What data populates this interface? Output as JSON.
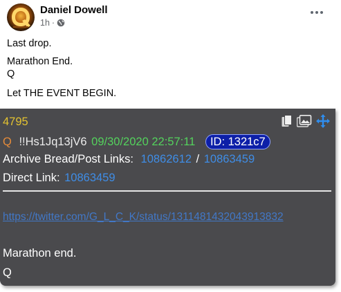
{
  "post": {
    "author": "Daniel Dowell",
    "time": "1h",
    "meta_sep": "·",
    "lines": [
      "Last drop.",
      "Marathon End.",
      "Q",
      "Let THE EVENT BEGIN."
    ],
    "privacy_icon": "globe-icon",
    "more_icon": "more-dots-icon"
  },
  "card": {
    "post_number": "4795",
    "q": "Q",
    "tripcode": "!!Hs1Jq13jV6",
    "date": "09/30/2020 22:57:11",
    "id": "ID: 1321c7",
    "archive_label": "Archive Bread/Post Links:",
    "archive_link_1": "10862612",
    "archive_slash": "/",
    "archive_link_2": "10863459",
    "direct_label": "Direct Link:",
    "direct_link": "10863459",
    "url": "https://twitter.com/G_L_C_K/status/1311481432043913832",
    "body_line_1": "Marathon end.",
    "body_line_2": "Q",
    "colors": {
      "card_bg": "#4a4a4d",
      "post_number": "#e3c231",
      "q": "#e58b3a",
      "date": "#54d25d",
      "id_pill": "#0d1fa8",
      "link": "#3f8de6"
    },
    "toolbar_icons": [
      "copy-icon",
      "image-icon",
      "move-icon"
    ]
  }
}
